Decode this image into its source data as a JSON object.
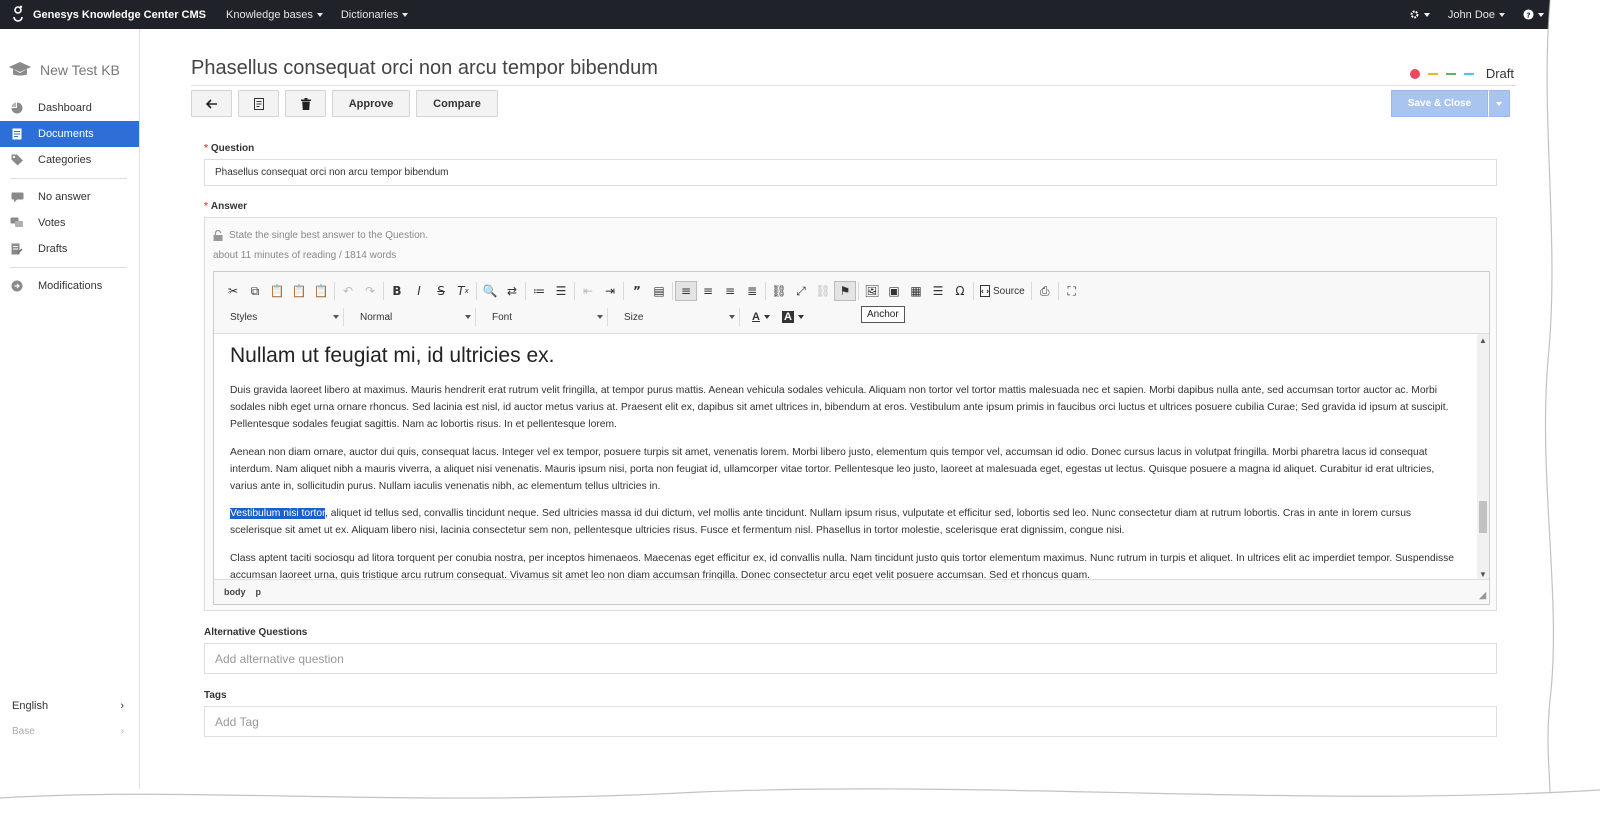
{
  "topbar": {
    "brand": "Genesys Knowledge Center CMS",
    "menu": [
      {
        "label": "Knowledge bases"
      },
      {
        "label": "Dictionaries"
      }
    ],
    "user": "John Doe"
  },
  "sidebar": {
    "kb_name": "New Test KB",
    "items": [
      {
        "label": "Dashboard",
        "icon": "pie-chart-icon"
      },
      {
        "label": "Documents",
        "icon": "document-icon",
        "active": true
      },
      {
        "label": "Categories",
        "icon": "tags-icon"
      },
      {
        "label": "No answer",
        "icon": "no-answer-icon"
      },
      {
        "label": "Votes",
        "icon": "votes-icon"
      },
      {
        "label": "Drafts",
        "icon": "drafts-icon"
      },
      {
        "label": "Modifications",
        "icon": "modifications-icon"
      }
    ],
    "language": "English",
    "base": "Base"
  },
  "document": {
    "title": "Phasellus consequat orci non arcu tempor bibendum",
    "status": "Draft",
    "status_colors": [
      "#e84a5f",
      "#f0b429",
      "#5cb85c",
      "#5bc0de"
    ]
  },
  "actions": {
    "approve": "Approve",
    "compare": "Compare",
    "save_close": "Save & Close"
  },
  "question": {
    "label": "Question",
    "value": "Phasellus consequat orci non arcu tempor bibendum"
  },
  "answer": {
    "label": "Answer",
    "hint": "State the single best answer to the Question.",
    "reading": "about 11 minutes of reading / 1814 words"
  },
  "editor": {
    "source_label": "Source",
    "styles": "Styles",
    "format": "Normal",
    "font": "Font",
    "size": "Size",
    "tooltip": "Anchor",
    "heading": "Nullam ut feugiat mi, id ultricies ex.",
    "p1": "Duis gravida laoreet libero at maximus. Mauris hendrerit erat rutrum velit fringilla, at tempor purus mattis. Aenean vehicula sodales vehicula. Aliquam non tortor vel tortor mattis malesuada nec et sapien. Morbi dapibus nulla ante, sed accumsan tortor auctor ac. Morbi sodales nibh eget urna ornare rhoncus. Sed lacinia est nisl, id auctor metus varius at. Praesent elit ex, dapibus sit amet ultrices in, bibendum at eros. Vestibulum ante ipsum primis in faucibus orci luctus et ultrices posuere cubilia Curae; Sed gravida id ipsum at suscipit. Pellentesque sodales feugiat sagittis. Nam ac lobortis risus. In et pellentesque lorem.",
    "p2": "Aenean non diam ornare, auctor dui quis, consequat lacus. Integer vel ex tempor, posuere turpis sit amet, venenatis lorem. Morbi libero justo, elementum quis tempor vel, accumsan id odio. Donec cursus lacus in volutpat fringilla. Morbi pharetra lacus id consequat interdum. Nam aliquet nibh a mauris viverra, a aliquet nisi venenatis. Mauris ipsum nisi, porta non feugiat id, ullamcorper vitae tortor. Pellentesque leo justo, laoreet at malesuada eget, egestas ut lectus. Quisque posuere a magna id aliquet. Curabitur id erat ultricies, varius ante in, sollicitudin purus. Nullam iaculis venenatis nibh, ac elementum tellus ultricies in.",
    "p3_selected": "Vestibulum nisi tortor",
    "p3_rest": ", aliquet id tellus sed, convallis tincidunt neque. Sed ultricies massa id dui dictum, vel mollis ante tincidunt. Nullam ipsum risus, vulputate et efficitur sed, lobortis sed leo. Nunc consectetur diam at rutrum lobortis. Cras in ante in lorem cursus scelerisque sit amet ut ex. Aliquam libero nisi, lacinia consectetur sem non, pellentesque ultricies risus. Fusce et fermentum nisl. Phasellus in tortor molestie, scelerisque erat dignissim, congue nisi.",
    "p4": "Class aptent taciti sociosqu ad litora torquent per conubia nostra, per inceptos himenaeos. Maecenas eget efficitur ex, id convallis nulla. Nam tincidunt justo quis tortor elementum maximus. Nunc rutrum in turpis et aliquet. In ultrices elit ac imperdiet tempor. Suspendisse accumsan laoreet urna, quis tristique arcu rutrum consequat. Vivamus sit amet leo non diam accumsan fringilla. Donec consectetur arcu eget velit posuere accumsan. Sed et rhoncus quam.",
    "path_body": "body",
    "path_p": "p"
  },
  "alt_questions": {
    "label": "Alternative Questions",
    "placeholder": "Add alternative question"
  },
  "tags": {
    "label": "Tags",
    "placeholder": "Add Tag"
  }
}
